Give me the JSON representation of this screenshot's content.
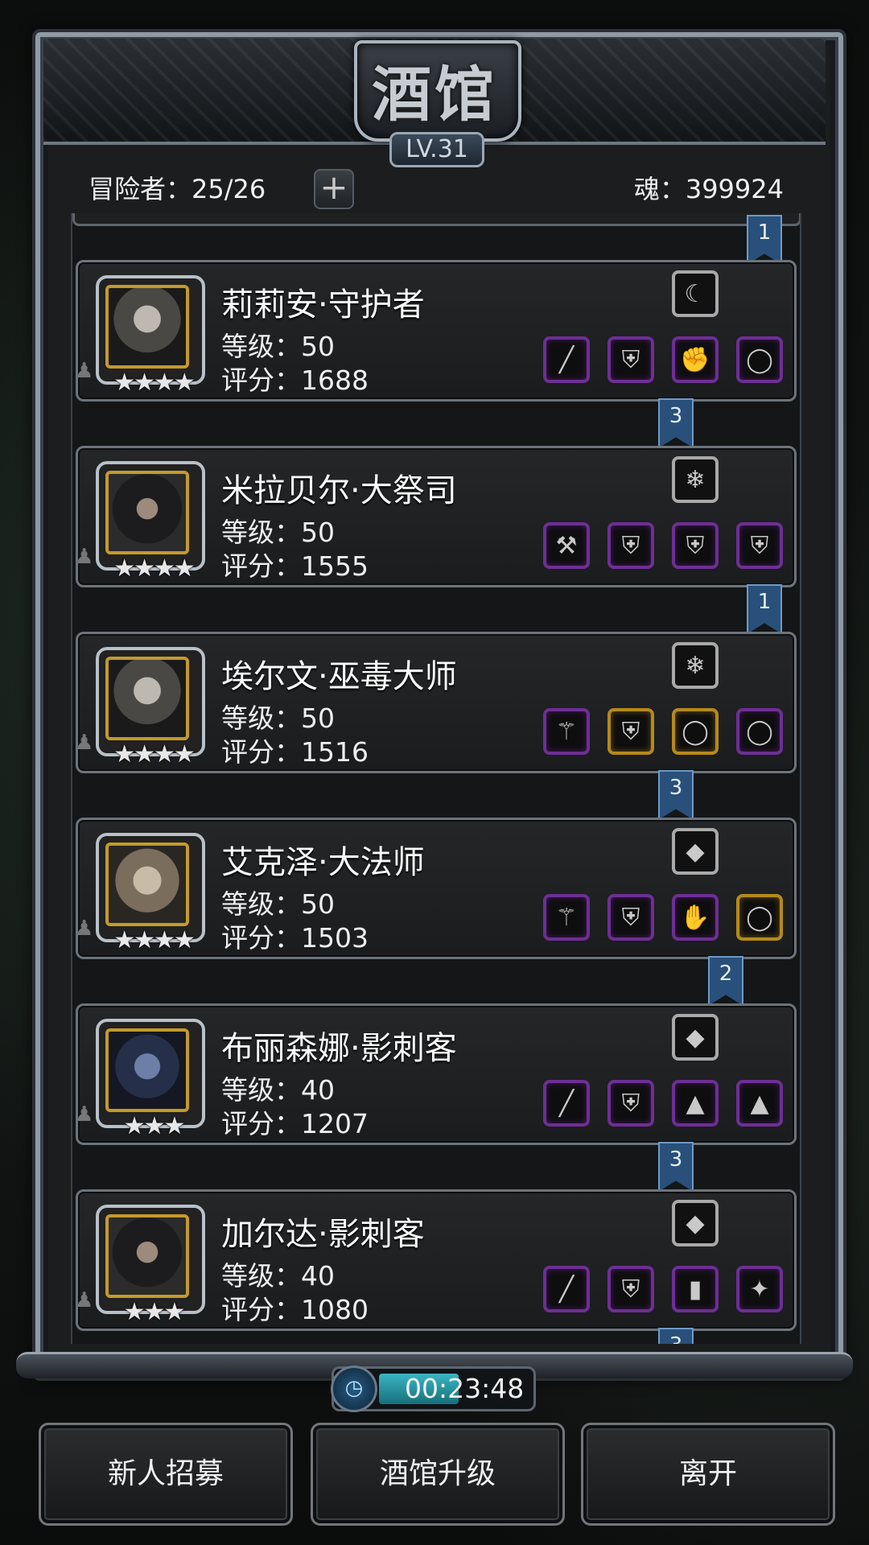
{
  "header": {
    "title": "酒馆",
    "level": "LV.31"
  },
  "stats": {
    "adventurers": "冒险者：25/26",
    "soul": "魂：399924",
    "add_icon": "plus-icon"
  },
  "heroes": [
    {
      "name": "莉莉安·守护者",
      "level": "等级：50",
      "score": "评分：1688",
      "stars": "★★★★",
      "portrait": "white-hair-warrior",
      "trait_icon": "claw-icon",
      "equipment": [
        {
          "icon": "spear-icon",
          "rarity": "purple"
        },
        {
          "icon": "chest-armor-icon",
          "rarity": "purple"
        },
        {
          "icon": "gauntlet-icon",
          "rarity": "purple"
        },
        {
          "icon": "ring-icon",
          "rarity": "purple"
        }
      ],
      "rank": "3"
    },
    {
      "name": "米拉贝尔·大祭司",
      "level": "等级：50",
      "score": "评分：1555",
      "stars": "★★★★",
      "portrait": "nun-priestess",
      "trait_icon": "crystal-blue-icon",
      "equipment": [
        {
          "icon": "hammer-icon",
          "rarity": "purple"
        },
        {
          "icon": "chest-armor-icon",
          "rarity": "purple"
        },
        {
          "icon": "vest-icon",
          "rarity": "purple"
        },
        {
          "icon": "vest-icon",
          "rarity": "purple"
        }
      ],
      "rank": "1"
    },
    {
      "name": "埃尔文·巫毒大师",
      "level": "等级：50",
      "score": "评分：1516",
      "stars": "★★★★",
      "portrait": "elf-male",
      "trait_icon": "crystal-blue-icon",
      "equipment": [
        {
          "icon": "staff-icon",
          "rarity": "purple"
        },
        {
          "icon": "chest-armor-icon",
          "rarity": "gold"
        },
        {
          "icon": "ring-icon",
          "rarity": "gold"
        },
        {
          "icon": "ring-icon",
          "rarity": "purple"
        }
      ],
      "rank": "3"
    },
    {
      "name": "艾克泽·大法师",
      "level": "等级：50",
      "score": "评分：1503",
      "stars": "★★★★",
      "portrait": "masked-mage",
      "trait_icon": "crystal-purple-icon",
      "equipment": [
        {
          "icon": "staff-icon",
          "rarity": "purple"
        },
        {
          "icon": "purple-armor-icon",
          "rarity": "purple"
        },
        {
          "icon": "claw-glove-icon",
          "rarity": "purple"
        },
        {
          "icon": "ring-icon",
          "rarity": "gold"
        }
      ],
      "rank": "2"
    },
    {
      "name": "布丽森娜·影刺客",
      "level": "等级：40",
      "score": "评分：1207",
      "stars": "★★★",
      "portrait": "dark-elf-female",
      "trait_icon": "crystal-purple-icon",
      "equipment": [
        {
          "icon": "dagger-icon",
          "rarity": "purple"
        },
        {
          "icon": "purple-armor-icon",
          "rarity": "purple"
        },
        {
          "icon": "cloak-icon",
          "rarity": "purple"
        },
        {
          "icon": "cloak-icon",
          "rarity": "purple"
        }
      ],
      "rank": "3"
    },
    {
      "name": "加尔达·影刺客",
      "level": "等级：40",
      "score": "评分：1080",
      "stars": "★★★",
      "portrait": "hooded-rogue",
      "trait_icon": "crystal-purple-icon",
      "equipment": [
        {
          "icon": "dagger-icon",
          "rarity": "purple"
        },
        {
          "icon": "purple-armor-icon",
          "rarity": "purple"
        },
        {
          "icon": "bracer-icon",
          "rarity": "purple"
        },
        {
          "icon": "amulet-icon",
          "rarity": "purple"
        }
      ],
      "rank": "3"
    }
  ],
  "top_rank": "1",
  "timer": {
    "time": "00:23:48",
    "progress": 0.55,
    "icon": "clock-icon"
  },
  "buttons": {
    "recruit": "新人招募",
    "upgrade": "酒馆升级",
    "leave": "离开"
  },
  "colors": {
    "purple_rarity": "#6d2f93",
    "gold_rarity": "#b58a1c",
    "rank_tag": "#28507a"
  }
}
